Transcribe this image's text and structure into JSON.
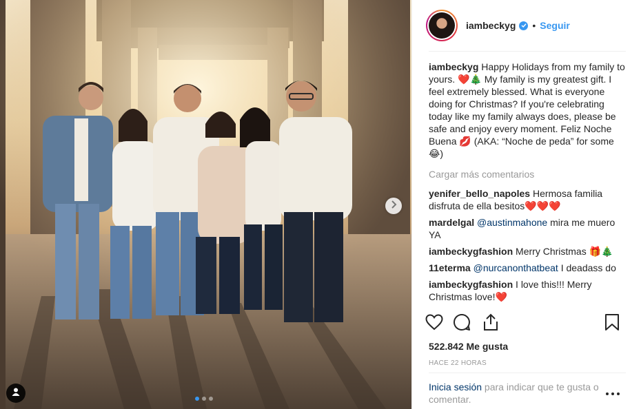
{
  "colors": {
    "accent": "#3897f0",
    "muted": "#999999",
    "mention": "#003569",
    "text": "#262626",
    "heart": "#ed4956"
  },
  "photo": {
    "icons": {
      "next": "chevron-right-icon",
      "tag": "user-tag-icon"
    },
    "carousel": {
      "count": 3,
      "active_index": 0
    }
  },
  "header": {
    "username": "iambeckyg",
    "verified": true,
    "separator": "•",
    "follow_label": "Seguir"
  },
  "caption": {
    "user": "iambeckyg",
    "text": "Happy Holidays from my family to yours. ❤️🎄 My family is my greatest gift. I feel extremely blessed. What is everyone doing for Christmas? If you're celebrating today like my family always does, please be safe and enjoy every moment. Feliz Noche Buena 💋 (AKA: “Noche de peda” for some 😂)"
  },
  "load_more_label": "Cargar más comentarios",
  "comments": [
    {
      "user": "yenifer_bello_napoles",
      "mention": "",
      "text": "Hermosa familia disfruta de ella besitos❤️❤️❤️"
    },
    {
      "user": "mardelgal",
      "mention": "@austinmahone",
      "text": " mira me muero YA"
    },
    {
      "user": "iambeckygfashion",
      "mention": "",
      "text": "Merry Christmas 🎁🎄"
    },
    {
      "user": "11eterma",
      "mention": "@nurcanonthatbeat",
      "text": " I deadass do"
    },
    {
      "user": "iambeckygfashion",
      "mention": "",
      "text": "I love this!!! Merry Christmas love!❤️"
    },
    {
      "user": "",
      "mention": "",
      "text": "🎄❤️🎉🎁"
    }
  ],
  "actions": {
    "like_icon": "heart-icon",
    "comment_icon": "comment-icon",
    "share_icon": "share-icon",
    "save_icon": "bookmark-icon"
  },
  "likes_label": "522.842 Me gusta",
  "time_label": "HACE 22 HORAS",
  "login": {
    "link_label": "Inicia sesión",
    "text": " para indicar que te gusta o comentar."
  },
  "more_options_icon": "more-options-icon"
}
